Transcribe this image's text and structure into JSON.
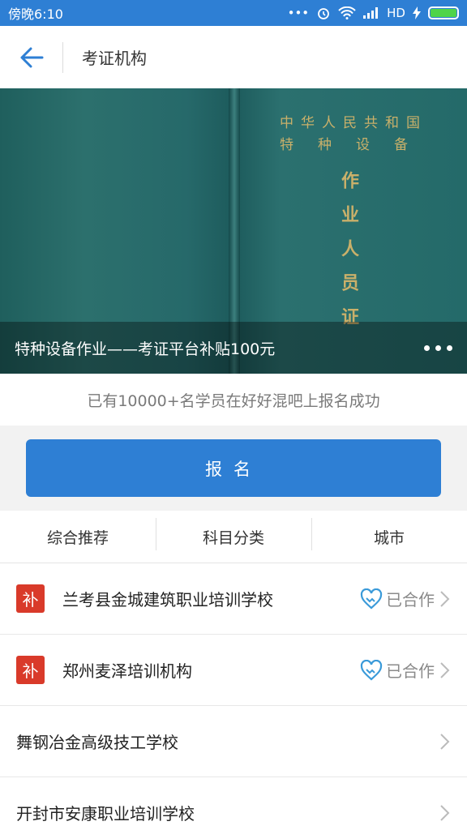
{
  "status_bar": {
    "time": "傍晚6:10",
    "signal_label": "HD"
  },
  "header": {
    "title": "考证机构"
  },
  "banner": {
    "cover_line1": "中华人民共和国",
    "cover_line2": "特种设备",
    "cover_vertical": "作业人员证",
    "caption": "特种设备作业——考证平台补贴100元"
  },
  "tagline": "已有10000+名学员在好好混吧上报名成功",
  "signup_label": "报名",
  "filters": [
    "综合推荐",
    "科目分类",
    "城市"
  ],
  "schools": [
    {
      "name": "兰考县金城建筑职业培训学校",
      "badge": "补",
      "status": "已合作"
    },
    {
      "name": "郑州麦泽培训机构",
      "badge": "补",
      "status": "已合作"
    },
    {
      "name": "舞钢冶金高级技工学校"
    },
    {
      "name": "开封市安康职业培训学校"
    }
  ],
  "colors": {
    "primary": "#2e7fd4",
    "badge_red": "#d93a2a",
    "battery_green": "#4fd44a"
  },
  "icons": {
    "back": "arrow-left-icon",
    "partner": "handshake-heart-icon",
    "chevron": "chevron-right-icon"
  }
}
